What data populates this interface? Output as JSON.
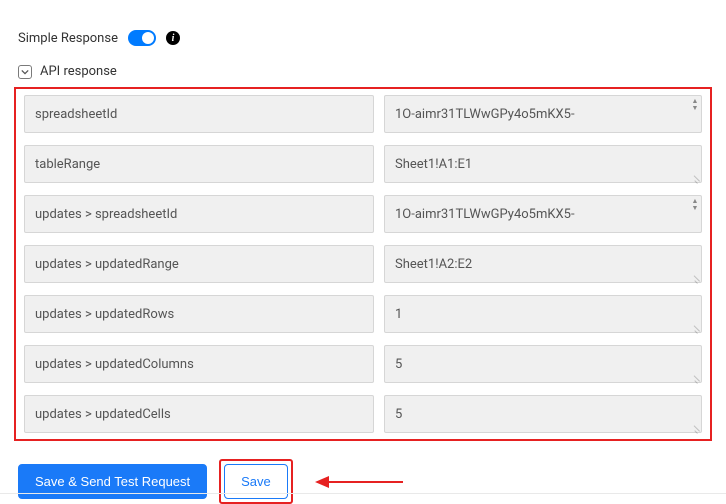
{
  "header": {
    "simple_response_label": "Simple Response"
  },
  "section": {
    "title": "API response"
  },
  "rows": [
    {
      "key": "spreadsheetId",
      "value": "1O-aimr31TLWwGPy4o5mKX5-",
      "scroll": true
    },
    {
      "key": "tableRange",
      "value": "Sheet1!A1:E1",
      "scroll": false
    },
    {
      "key": "updates > spreadsheetId",
      "value": "1O-aimr31TLWwGPy4o5mKX5-",
      "scroll": true
    },
    {
      "key": "updates > updatedRange",
      "value": "Sheet1!A2:E2",
      "scroll": false
    },
    {
      "key": "updates > updatedRows",
      "value": "1",
      "scroll": false
    },
    {
      "key": "updates > updatedColumns",
      "value": "5",
      "scroll": false
    },
    {
      "key": "updates > updatedCells",
      "value": "5",
      "scroll": false
    }
  ],
  "buttons": {
    "primary": "Save & Send Test Request",
    "save": "Save"
  }
}
